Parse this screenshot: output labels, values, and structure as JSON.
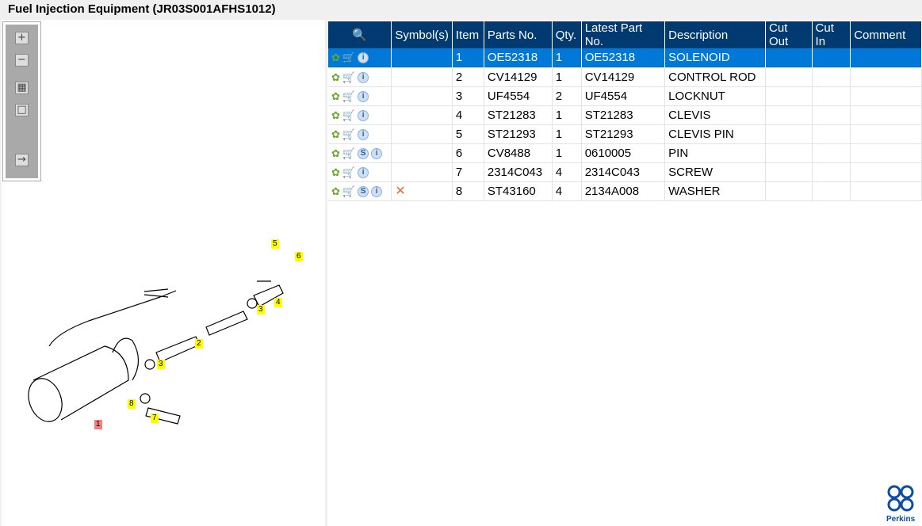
{
  "title": "Fuel Injection Equipment (JR03S001AFHS1012)",
  "toolbar": {
    "items": [
      "zoom-in",
      "zoom-out",
      "fit-all",
      "fit-window",
      "toggle-panel"
    ]
  },
  "table": {
    "headers": [
      "",
      "Symbol(s)",
      "Item",
      "Parts No.",
      "Qty.",
      "Latest Part No.",
      "Description",
      "Cut Out",
      "Cut In",
      "Comment"
    ],
    "rows": [
      {
        "item": "1",
        "parts_no": "OE52318",
        "qty": "1",
        "latest": "OE52318",
        "desc": "SOLENOID",
        "s": false,
        "symbol": "",
        "selected": true
      },
      {
        "item": "2",
        "parts_no": "CV14129",
        "qty": "1",
        "latest": "CV14129",
        "desc": "CONTROL ROD",
        "s": false,
        "symbol": ""
      },
      {
        "item": "3",
        "parts_no": "UF4554",
        "qty": "2",
        "latest": "UF4554",
        "desc": "LOCKNUT",
        "s": false,
        "symbol": ""
      },
      {
        "item": "4",
        "parts_no": "ST21283",
        "qty": "1",
        "latest": "ST21283",
        "desc": "CLEVIS",
        "s": false,
        "symbol": ""
      },
      {
        "item": "5",
        "parts_no": "ST21293",
        "qty": "1",
        "latest": "ST21293",
        "desc": "CLEVIS PIN",
        "s": false,
        "symbol": ""
      },
      {
        "item": "6",
        "parts_no": "CV8488",
        "qty": "1",
        "latest": "0610005",
        "desc": "PIN",
        "s": true,
        "symbol": ""
      },
      {
        "item": "7",
        "parts_no": "2314C043",
        "qty": "4",
        "latest": "2314C043",
        "desc": "SCREW",
        "s": false,
        "symbol": ""
      },
      {
        "item": "8",
        "parts_no": "ST43160",
        "qty": "4",
        "latest": "2134A008",
        "desc": "WASHER",
        "s": true,
        "symbol": "✕"
      }
    ]
  },
  "diagram": {
    "callouts": [
      "5",
      "6",
      "4",
      "3",
      "2",
      "3",
      "8",
      "7",
      "1"
    ]
  },
  "logo": {
    "text": "Perkins"
  },
  "colors": {
    "header": "#003a70",
    "selected": "#0078d7"
  }
}
